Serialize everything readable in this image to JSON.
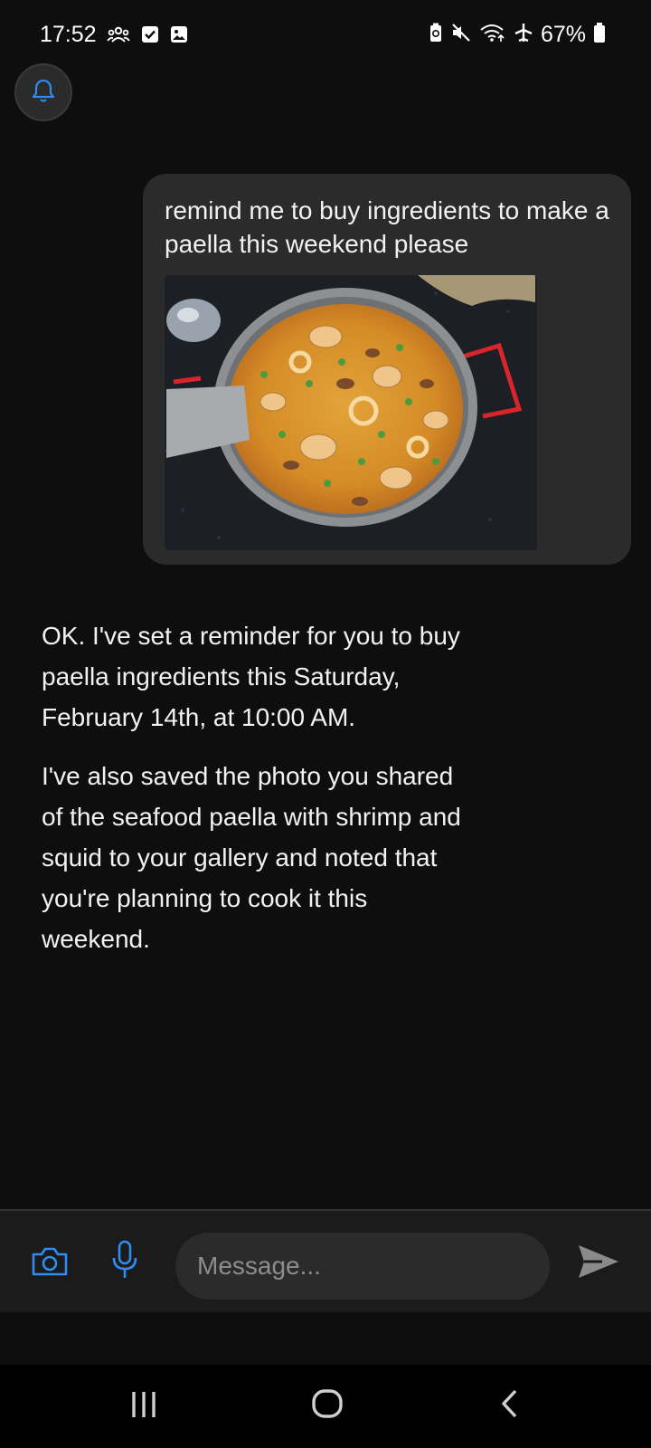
{
  "status_bar": {
    "time": "17:52",
    "battery_percent": "67%",
    "icons_left": [
      "people-icon",
      "checkbox-icon",
      "image-icon"
    ],
    "icons_right": [
      "battery-saver-icon",
      "mute-icon",
      "wifi-icon",
      "airplane-icon",
      "battery-icon"
    ]
  },
  "notification": {
    "icon": "bell-icon"
  },
  "conversation": {
    "user_message": {
      "text": "remind me to buy ingredients to make a paella this weekend please",
      "has_photo": true
    },
    "assistant_message": {
      "paragraphs": [
        "OK. I've set a reminder for you to buy paella ingredients this Saturday, February 14th, at 10:00 AM.",
        "I've also saved the photo you shared of the seafood paella with shrimp and squid to your gallery and noted that you're planning to cook it this weekend."
      ]
    }
  },
  "composer": {
    "placeholder": "Message...",
    "value": "",
    "camera_icon": "camera-icon",
    "mic_icon": "microphone-icon",
    "send_icon": "send-icon"
  },
  "nav_bar": {
    "buttons": [
      "recents-icon",
      "home-icon",
      "back-icon"
    ]
  },
  "colors": {
    "background": "#0e0e0e",
    "bubble": "#2b2b2b",
    "accent_blue": "#2f8cf0",
    "composer_bg": "#1b1b1b",
    "navbar_bg": "#000000"
  }
}
